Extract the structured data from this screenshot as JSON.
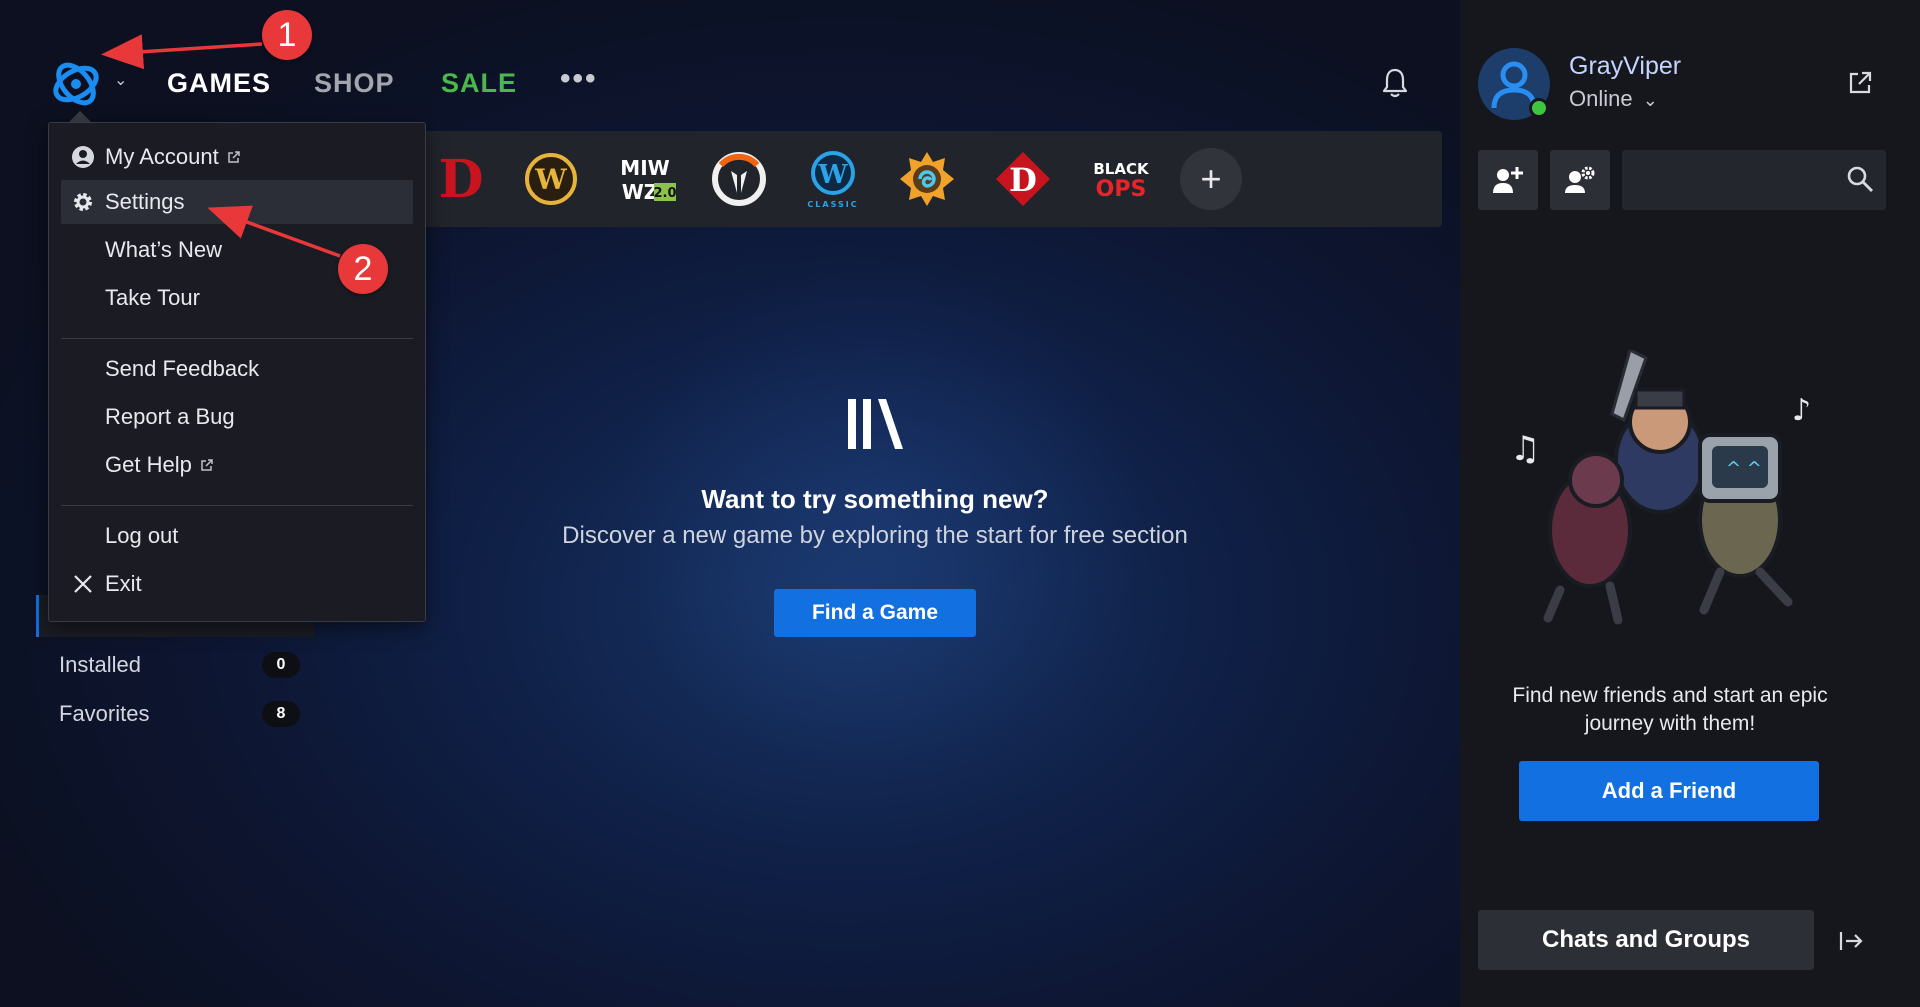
{
  "window": {
    "minimize": "—",
    "restore": "❐",
    "close": "✕"
  },
  "nav": {
    "games": "GAMES",
    "shop": "SHOP",
    "sale": "SALE",
    "more": "•••"
  },
  "menu": {
    "items": [
      {
        "label": "My Account",
        "icon": "user-circle-icon",
        "external": true
      },
      {
        "label": "Settings",
        "icon": "gear-icon",
        "external": false,
        "highlighted": true
      },
      {
        "label": "What’s New",
        "icon": "",
        "external": false
      },
      {
        "label": "Take Tour",
        "icon": "",
        "external": false
      },
      {
        "label": "Send Feedback",
        "icon": "",
        "external": false
      },
      {
        "label": "Report a Bug",
        "icon": "",
        "external": false
      },
      {
        "label": "Get Help",
        "icon": "",
        "external": true
      },
      {
        "label": "Log out",
        "icon": "",
        "external": false
      },
      {
        "label": "Exit",
        "icon": "close-icon",
        "external": false
      }
    ]
  },
  "games_bar": {
    "games": [
      {
        "name": "diablo-iv",
        "mark": "D",
        "color": "#c8141e"
      },
      {
        "name": "world-of-warcraft",
        "mark": "W",
        "color": "#e6b43a"
      },
      {
        "name": "mw2-warzone",
        "mark": "MWII WZ2.0",
        "color": "#ffffff"
      },
      {
        "name": "overwatch",
        "mark": "",
        "color": "#f0f0f0"
      },
      {
        "name": "wow-classic",
        "mark": "W",
        "sub": "CLASSIC",
        "color": "#2aa3e8"
      },
      {
        "name": "hearthstone",
        "mark": "",
        "color": "#f0a22a"
      },
      {
        "name": "diablo-immortal",
        "mark": "D",
        "color": "#ffffff"
      },
      {
        "name": "black-ops",
        "mark": "BLACK",
        "sub": "OPS",
        "color": "#ffffff"
      }
    ],
    "add": "+"
  },
  "promo": {
    "title": "Want to try something new?",
    "subtitle": "Discover a new game by exploring the start for free section",
    "button": "Find a Game"
  },
  "library": {
    "items": [
      {
        "label": "Installed",
        "count": "0"
      },
      {
        "label": "Favorites",
        "count": "8"
      }
    ]
  },
  "annotations": {
    "badge1": "1",
    "badge2": "2"
  },
  "profile": {
    "username": "GrayViper",
    "status": "Online",
    "status_color": "#3fc43f"
  },
  "social": {
    "search_placeholder": "",
    "empty_text": "Find new friends and start an epic journey with them!",
    "add_friend": "Add a Friend",
    "chats": "Chats and Groups"
  },
  "colors": {
    "accent": "#1270e0",
    "sale": "#4ab84a",
    "annotation": "#e8383a"
  }
}
